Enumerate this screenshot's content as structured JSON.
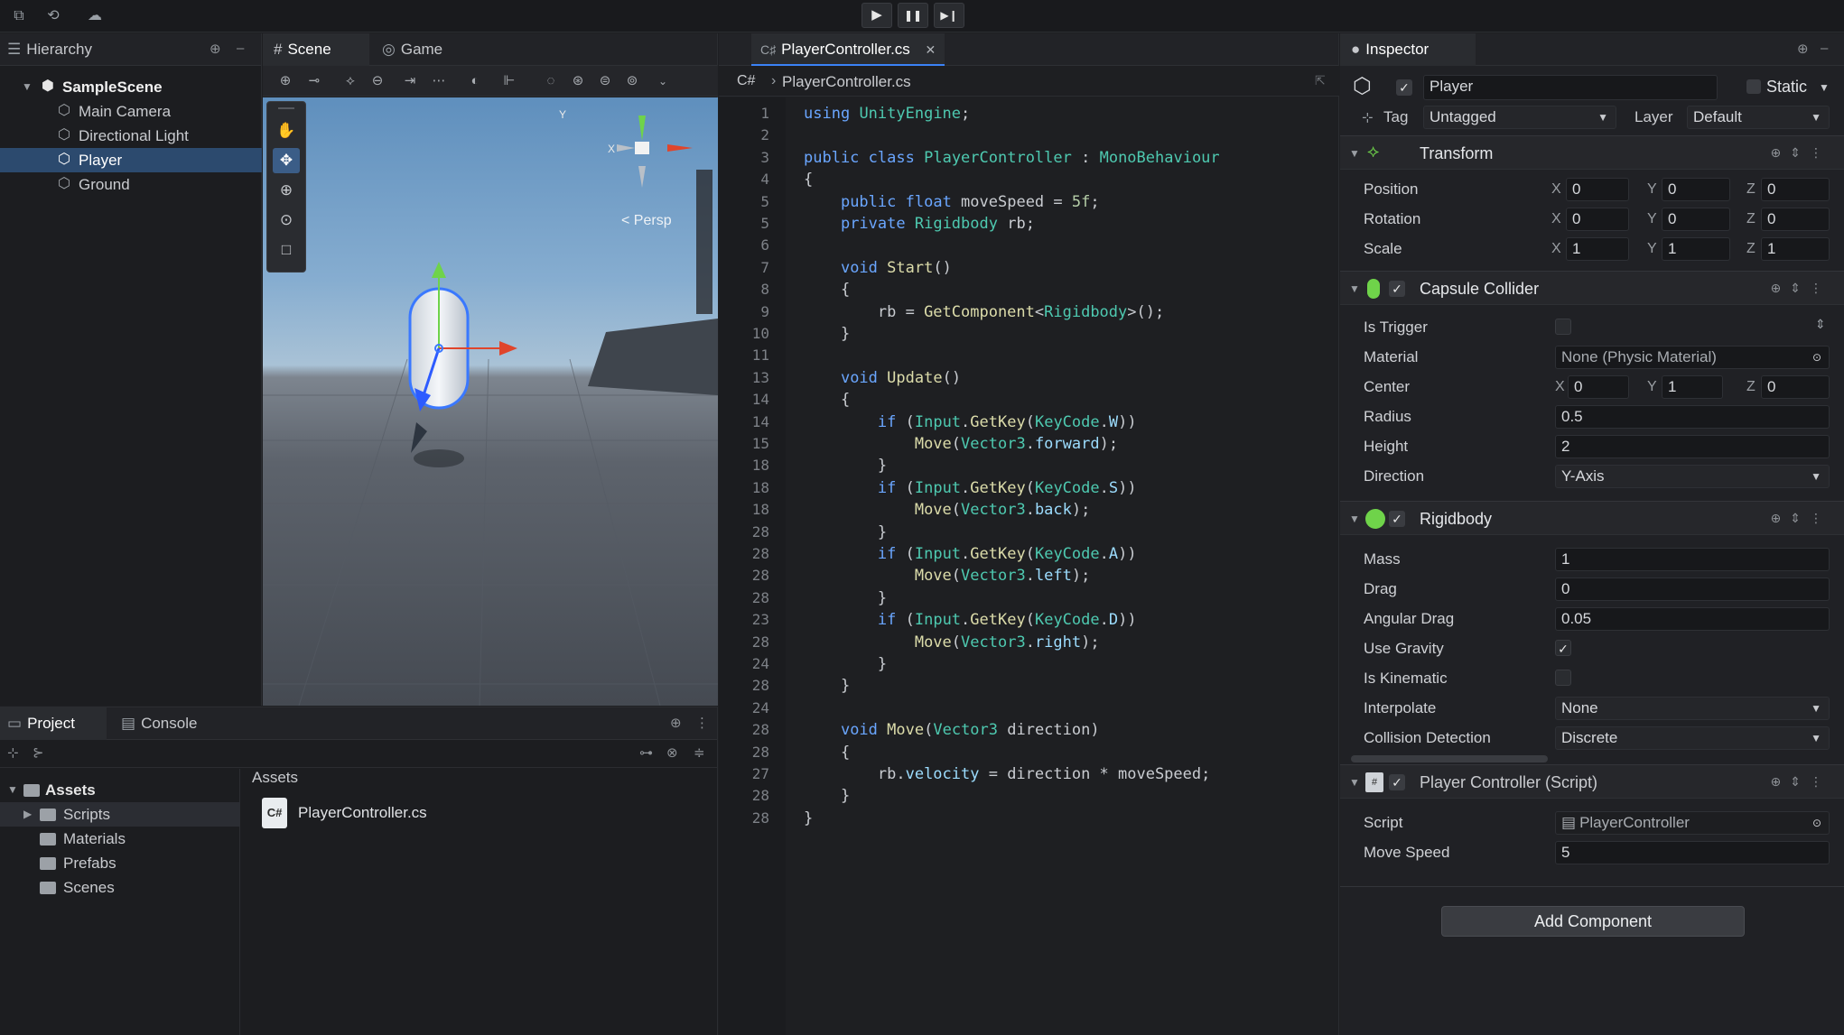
{
  "toolbar": {
    "play": "▶",
    "pause": "❚❚",
    "step": "▶❙"
  },
  "hierarchy": {
    "tab": "Hierarchy",
    "scene": "SampleScene",
    "items": [
      "Main Camera",
      "Directional Light",
      "Player",
      "Ground"
    ],
    "selected": "Player"
  },
  "scene_view": {
    "tabs": [
      "Scene",
      "Game"
    ],
    "gizmo": {
      "y": "Y",
      "x": "X",
      "persp": "< Persp"
    }
  },
  "project": {
    "tabs": [
      "Project",
      "Console"
    ],
    "tree": [
      "Assets",
      "Scripts",
      "Materials",
      "Prefabs",
      "Scenes"
    ],
    "breadcrumb": "Assets",
    "files": [
      {
        "name": "PlayerController.cs",
        "badge": "C#"
      }
    ]
  },
  "editor": {
    "tab": "PlayerController.cs",
    "breadcrumb_lang": "C#",
    "breadcrumb_file": "PlayerController.cs",
    "line_numbers": [
      "1",
      "2",
      "3",
      "4",
      "5",
      "5",
      "6",
      "7",
      "8",
      "9",
      "10",
      "11",
      "13",
      "14",
      "14",
      "15",
      "18",
      "18",
      "18",
      "28",
      "28",
      "28",
      "28",
      "23",
      "28",
      "24",
      "28",
      "24",
      "28",
      "28",
      "27",
      "28",
      "28"
    ],
    "lines": [
      "using UnityEngine;",
      "",
      "public class PlayerController : MonoBehaviour",
      "{",
      "    public float moveSpeed = 5f;",
      "    private Rigidbody rb;",
      "",
      "    void Start()",
      "    {",
      "        rb = GetComponent<Rigidbody>();",
      "    }",
      "",
      "    void Update()",
      "    {",
      "        if (Input.GetKey(KeyCode.W))",
      "            Move(Vector3.forward);",
      "        }",
      "        if (Input.GetKey(KeyCode.S))",
      "            Move(Vector3.back);",
      "        }",
      "        if (Input.GetKey(KeyCode.A))",
      "            Move(Vector3.left);",
      "        }",
      "        if (Input.GetKey(KeyCode.D))",
      "            Move(Vector3.right);",
      "        }",
      "    }",
      "",
      "    void Move(Vector3 direction)",
      "    {",
      "        rb.velocity = direction * moveSpeed;",
      "    }",
      "}"
    ]
  },
  "inspector": {
    "tab": "Inspector",
    "object_name": "Player",
    "static_label": "Static",
    "tag_label": "Tag",
    "tag_value": "Untagged",
    "layer_label": "Layer",
    "layer_value": "Default",
    "transform": {
      "title": "Transform",
      "rows": [
        {
          "label": "Position",
          "x": "0",
          "y": "0",
          "z": "0"
        },
        {
          "label": "Rotation",
          "x": "0",
          "y": "0",
          "z": "0"
        },
        {
          "label": "Scale",
          "x": "1",
          "y": "1",
          "z": "1"
        }
      ]
    },
    "capsule": {
      "title": "Capsule Collider",
      "is_trigger": "Is Trigger",
      "material_label": "Material",
      "material_value": "None (Physic Material)",
      "center_label": "Center",
      "center": {
        "x": "0",
        "y": "1",
        "z": "0"
      },
      "radius_label": "Radius",
      "radius": "0.5",
      "height_label": "Height",
      "height": "2",
      "direction_label": "Direction",
      "direction": "Y-Axis"
    },
    "rigidbody": {
      "title": "Rigidbody",
      "mass_label": "Mass",
      "mass": "1",
      "drag_label": "Drag",
      "drag": "0",
      "angular_label": "Angular Drag",
      "angular": "0.05",
      "gravity_label": "Use Gravity",
      "kinematic_label": "Is Kinematic",
      "interp_label": "Interpolate",
      "interp": "None",
      "collision_label": "Collision Detection",
      "collision": "Discrete"
    },
    "script": {
      "title": "Player Controller (Script)",
      "script_label": "Script",
      "script_value": "PlayerController",
      "speed_label": "Move Speed",
      "speed": "5"
    },
    "add_component": "Add Component"
  },
  "axis_labels": {
    "x": "X",
    "y": "Y",
    "z": "Z"
  },
  "colors": {
    "selection": "#2c4a6e",
    "accent_blue": "#3b5d87",
    "green_check": "#44aa44"
  }
}
